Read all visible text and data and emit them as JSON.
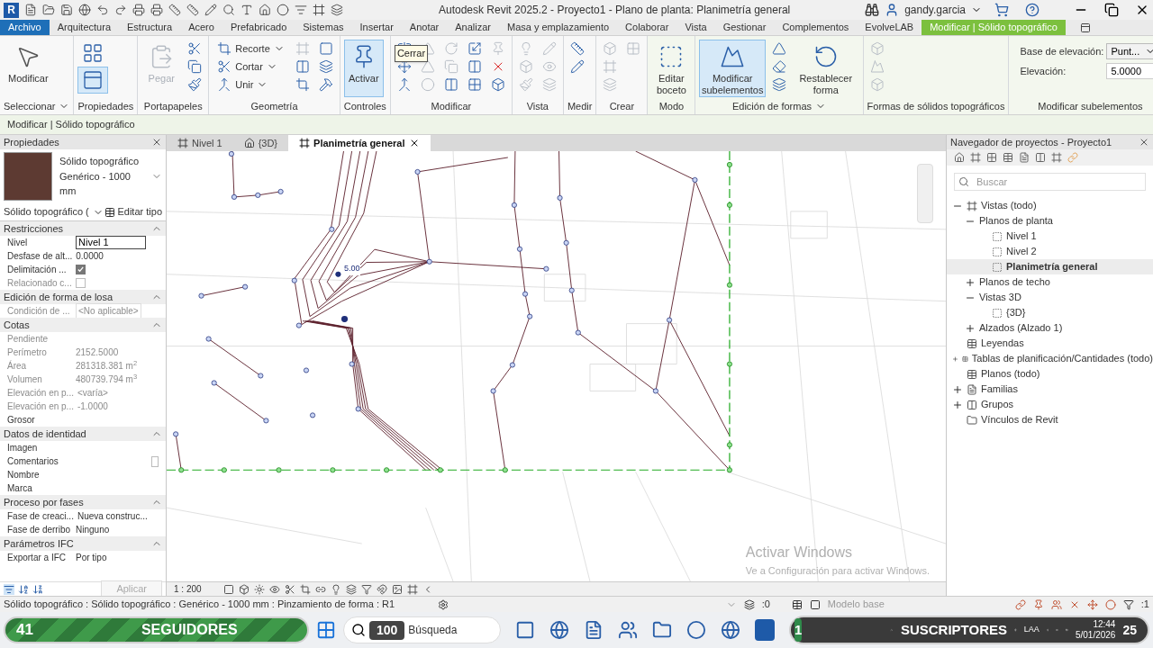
{
  "title_bar": {
    "logo": "R",
    "title": "Autodesk Revit 2025.2 - Proyecto1 - Plano de planta: Planimetría general",
    "user": "gandy.garcia"
  },
  "menu_tabs": [
    {
      "label": "Archivo",
      "kind": "file",
      "selected": false
    },
    {
      "label": "Arquitectura",
      "kind": "tab",
      "selected": false
    },
    {
      "label": "Estructura",
      "kind": "tab",
      "selected": false
    },
    {
      "label": "Acero",
      "kind": "tab",
      "selected": false
    },
    {
      "label": "Prefabricado",
      "kind": "tab",
      "selected": false
    },
    {
      "label": "Sistemas",
      "kind": "tab",
      "selected": false
    },
    {
      "label": "Insertar",
      "kind": "tab",
      "selected": false
    },
    {
      "label": "Anotar",
      "kind": "tab",
      "selected": false
    },
    {
      "label": "Analizar",
      "kind": "tab",
      "selected": false
    },
    {
      "label": "Masa y emplazamiento",
      "kind": "tab",
      "selected": false
    },
    {
      "label": "Colaborar",
      "kind": "tab",
      "selected": false
    },
    {
      "label": "Vista",
      "kind": "tab",
      "selected": false
    },
    {
      "label": "Gestionar",
      "kind": "tab",
      "selected": false
    },
    {
      "label": "Complementos",
      "kind": "tab",
      "selected": false
    },
    {
      "label": "EvolveLAB",
      "kind": "tab",
      "selected": false
    },
    {
      "label": "Modificar | Sólido topográfico",
      "kind": "context",
      "selected": true
    }
  ],
  "ribbon": {
    "panels": [
      {
        "label": "Seleccionar",
        "dropdown": true,
        "buttons": [
          {
            "kind": "large",
            "label": "Modificar",
            "active": false,
            "disabled": false
          }
        ]
      },
      {
        "label": "Propiedades",
        "dropdown": false,
        "buttons": [
          {
            "kind": "big_icon",
            "active": false,
            "disabled": false
          },
          {
            "kind": "big_icon",
            "active": true,
            "disabled": false
          }
        ]
      },
      {
        "label": "Portapapeles",
        "dropdown": false,
        "buttons": [
          {
            "kind": "large",
            "label": "Pegar",
            "active": false,
            "disabled": true
          },
          {
            "kind": "icon",
            "active": false,
            "disabled": false
          },
          {
            "kind": "icon",
            "active": false,
            "disabled": false
          },
          {
            "kind": "icon",
            "active": false,
            "disabled": false
          }
        ]
      },
      {
        "label": "Geometría",
        "dropdown": false,
        "buttons": [
          {
            "kind": "small",
            "label": "Recorte",
            "active": false,
            "disabled": false
          },
          {
            "kind": "small",
            "label": "Cortar",
            "active": false,
            "disabled": false
          },
          {
            "kind": "small",
            "label": "Unir",
            "active": false,
            "disabled": false
          },
          {
            "kind": "icon",
            "active": false,
            "disabled": true
          },
          {
            "kind": "icon",
            "active": false,
            "disabled": false
          },
          {
            "kind": "icon",
            "active": false,
            "disabled": false
          },
          {
            "kind": "icon",
            "active": false,
            "disabled": false
          },
          {
            "kind": "icon",
            "active": false,
            "disabled": false
          },
          {
            "kind": "icon",
            "active": false,
            "disabled": false
          }
        ]
      },
      {
        "label": "Controles",
        "dropdown": false,
        "buttons": [
          {
            "kind": "large",
            "label": "Activar",
            "active": true,
            "disabled": false
          }
        ]
      },
      {
        "label": "Modificar",
        "dropdown": false,
        "tooltip": "Cerrar",
        "buttons": [
          {
            "kind": "icon",
            "active": false,
            "disabled": false
          },
          {
            "kind": "icon",
            "active": false,
            "disabled": false
          },
          {
            "kind": "icon",
            "active": false,
            "disabled": false
          },
          {
            "kind": "icon",
            "active": false,
            "disabled": true
          },
          {
            "kind": "icon",
            "active": false,
            "disabled": true
          },
          {
            "kind": "icon",
            "active": false,
            "disabled": true
          },
          {
            "kind": "icon",
            "active": false,
            "disabled": true
          },
          {
            "kind": "icon",
            "active": false,
            "disabled": true
          },
          {
            "kind": "icon",
            "active": false,
            "disabled": false
          },
          {
            "kind": "icon",
            "active": false,
            "disabled": false
          },
          {
            "kind": "icon",
            "active": false,
            "disabled": false
          },
          {
            "kind": "icon",
            "active": false,
            "disabled": false
          },
          {
            "kind": "icon",
            "active": false,
            "disabled": true
          },
          {
            "kind": "icon",
            "active": false,
            "disabled": false
          },
          {
            "kind": "icon",
            "active": false,
            "disabled": false
          }
        ]
      },
      {
        "label": "Vista",
        "dropdown": false,
        "buttons": [
          {
            "kind": "icon",
            "active": false,
            "disabled": true
          },
          {
            "kind": "icon",
            "active": false,
            "disabled": true
          },
          {
            "kind": "icon",
            "active": false,
            "disabled": true
          },
          {
            "kind": "icon",
            "active": false,
            "disabled": true
          },
          {
            "kind": "icon",
            "active": false,
            "disabled": true
          },
          {
            "kind": "icon",
            "active": false,
            "disabled": true
          }
        ]
      },
      {
        "label": "Medir",
        "dropdown": false,
        "buttons": [
          {
            "kind": "icon",
            "active": false,
            "disabled": false
          },
          {
            "kind": "icon",
            "active": false,
            "disabled": false
          }
        ]
      },
      {
        "label": "Crear",
        "dropdown": false,
        "buttons": [
          {
            "kind": "icon",
            "active": false,
            "disabled": true
          },
          {
            "kind": "icon",
            "active": false,
            "disabled": true
          },
          {
            "kind": "icon",
            "active": false,
            "disabled": true
          },
          {
            "kind": "icon",
            "active": false,
            "disabled": true
          }
        ]
      },
      {
        "label": "Modo",
        "dropdown": false,
        "buttons": [
          {
            "kind": "large",
            "label": "Editar boceto",
            "active": false,
            "disabled": false
          }
        ]
      },
      {
        "label": "Edición de formas",
        "dropdown": true,
        "buttons": [
          {
            "kind": "large",
            "label": "Modificar subelementos",
            "active": true,
            "disabled": false
          },
          {
            "kind": "icon",
            "active": false,
            "disabled": false
          },
          {
            "kind": "icon",
            "active": false,
            "disabled": false
          },
          {
            "kind": "icon",
            "active": false,
            "disabled": false
          },
          {
            "kind": "large",
            "label": "Restablecer forma",
            "active": false,
            "disabled": false
          }
        ]
      },
      {
        "label": "Formas de sólidos topográficos",
        "dropdown": false,
        "buttons": [
          {
            "kind": "icon",
            "active": false,
            "disabled": true
          },
          {
            "kind": "icon",
            "active": false,
            "disabled": true
          },
          {
            "kind": "icon",
            "active": false,
            "disabled": true
          }
        ]
      },
      {
        "label": "Modificar subelementos",
        "dropdown": false,
        "fields": [
          {
            "label": "Base de elevación:",
            "kind": "select",
            "value": "Punt..."
          },
          {
            "label": "Elevación:",
            "kind": "input",
            "value": "5.0000"
          }
        ]
      }
    ]
  },
  "context_bar": "Modificar | Sólido topográfico",
  "properties": {
    "title": "Propiedades",
    "type_name": "Sólido topográfico",
    "type_sub": "Genérico - 1000 mm",
    "instance_selector": "Sólido topográfico (",
    "edit_type": "Editar tipo",
    "groups": [
      {
        "name": "Restricciones",
        "rows": [
          {
            "label": "Nivel",
            "kind": "input",
            "value": "Nivel 1",
            "disabled": false
          },
          {
            "label": "Desfase de alt...",
            "kind": "text",
            "value": "0.0000",
            "disabled": false
          },
          {
            "label": "Delimitación ...",
            "kind": "checkbox",
            "checked": true,
            "disabled": false
          },
          {
            "label": "Relacionado c...",
            "kind": "checkbox",
            "checked": false,
            "disabled": true
          }
        ]
      },
      {
        "name": "Edición de forma de losa",
        "rows": [
          {
            "label": "Condición de ...",
            "kind": "box",
            "value": "<No aplicable>",
            "disabled": true
          }
        ]
      },
      {
        "name": "Cotas",
        "rows": [
          {
            "label": "Pendiente",
            "kind": "text",
            "value": "",
            "disabled": true
          },
          {
            "label": "Perímetro",
            "kind": "text",
            "value": "2152.5000",
            "disabled": true
          },
          {
            "label": "Área",
            "kind": "text",
            "value": "281318.381 m$^{2}$",
            "disabled": true
          },
          {
            "label": "Volumen",
            "kind": "text",
            "value": "480739.794 m$^{3}$",
            "disabled": true
          },
          {
            "label": "Elevación en p...",
            "kind": "text",
            "value": "<varía>",
            "disabled": true
          },
          {
            "label": "Elevación en p...",
            "kind": "text",
            "value": "-1.0000",
            "disabled": true
          },
          {
            "label": "Grosor",
            "kind": "text",
            "value": "",
            "disabled": false
          }
        ]
      },
      {
        "name": "Datos de identidad",
        "rows": [
          {
            "label": "Imagen",
            "kind": "text",
            "value": "",
            "disabled": false
          },
          {
            "label": "Comentarios",
            "kind": "button",
            "value": "",
            "disabled": false
          },
          {
            "label": "Nombre",
            "kind": "text",
            "value": "",
            "disabled": false
          },
          {
            "label": "Marca",
            "kind": "text",
            "value": "",
            "disabled": false
          }
        ]
      },
      {
        "name": "Proceso por fases",
        "rows": [
          {
            "label": "Fase de creaci...",
            "kind": "text",
            "value": "Nueva construc...",
            "disabled": false
          },
          {
            "label": "Fase de derribo",
            "kind": "text",
            "value": "Ninguno",
            "disabled": false
          }
        ]
      },
      {
        "name": "Parámetros IFC",
        "rows": [
          {
            "label": "Exportar a IFC",
            "kind": "text",
            "value": "Por tipo",
            "disabled": false
          }
        ]
      }
    ],
    "apply": "Aplicar"
  },
  "view_tabs": [
    {
      "label": "Nivel 1",
      "selected": false
    },
    {
      "label": "{3D}",
      "selected": false
    },
    {
      "label": "Planimetría general",
      "selected": true
    }
  ],
  "canvas": {
    "spot_label": "5.00",
    "scale": "1 : 200",
    "notice_title": "Activar Windows",
    "notice_text": "Ve a Configuración para activar Windows."
  },
  "browser": {
    "title": "Navegador de proyectos - Proyecto1",
    "search_placeholder": "Buscar",
    "tree": [
      {
        "label": "Vistas (todo)",
        "expanded": true,
        "selected": false,
        "children": [
          {
            "label": "Planos de planta",
            "expanded": true,
            "selected": false,
            "children": [
              {
                "label": "Nivel 1",
                "selected": false
              },
              {
                "label": "Nivel 2",
                "selected": false
              },
              {
                "label": "Planimetría general",
                "selected": true
              }
            ]
          },
          {
            "label": "Planos de techo",
            "expanded": false,
            "selected": false
          },
          {
            "label": "Vistas 3D",
            "expanded": true,
            "selected": false,
            "children": [
              {
                "label": "{3D}",
                "selected": false
              }
            ]
          },
          {
            "label": "Alzados (Alzado 1)",
            "expanded": false,
            "selected": false
          }
        ]
      },
      {
        "label": "Leyendas",
        "selected": false
      },
      {
        "label": "Tablas de planificación/Cantidades (todo)",
        "expanded": false,
        "selected": false
      },
      {
        "label": "Planos (todo)",
        "selected": false
      },
      {
        "label": "Familias",
        "expanded": false,
        "selected": false
      },
      {
        "label": "Grupos",
        "expanded": false,
        "selected": false
      },
      {
        "label": "Vínculos de Revit",
        "selected": false
      }
    ]
  },
  "status_bar": {
    "text": "Sólido topográfico : Sólido topográfico : Genérico - 1000 mm : Pinzamiento de forma : R1",
    "count": ":0",
    "model": "Modelo base",
    "filter_count": ":1"
  },
  "taskbar": {
    "followers_count": "41",
    "followers_label": "SEGUIDORES",
    "search_badge": "100",
    "search_placeholder": "Búsqueda",
    "subscribers_count": "1",
    "subscribers_label": "SUSCRIPTORES",
    "keyboard": "LAA",
    "time": "12:44",
    "date": "5/01/2026",
    "badge": "25"
  }
}
